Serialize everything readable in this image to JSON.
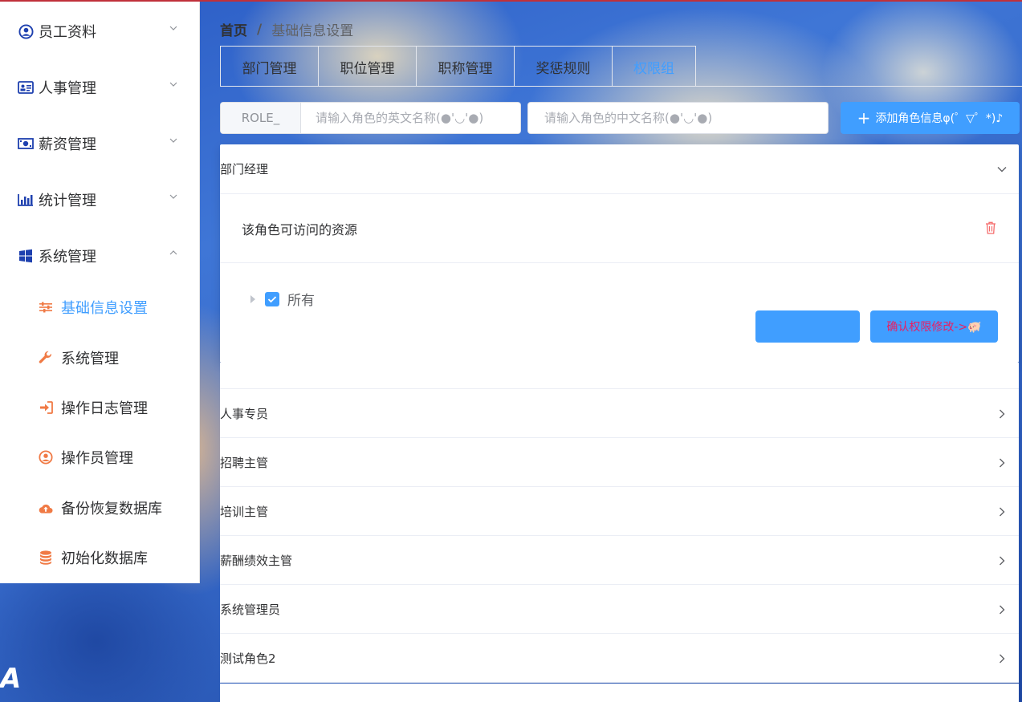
{
  "sidebar": {
    "menus": [
      {
        "label": "员工资料",
        "icon": "user-circle-icon"
      },
      {
        "label": "人事管理",
        "icon": "id-card-icon"
      },
      {
        "label": "薪资管理",
        "icon": "money-icon"
      },
      {
        "label": "统计管理",
        "icon": "bar-chart-icon"
      },
      {
        "label": "系统管理",
        "icon": "windows-icon"
      }
    ],
    "submenus": [
      {
        "label": "基础信息设置",
        "icon": "sliders-icon",
        "active": true
      },
      {
        "label": "系统管理",
        "icon": "wrench-icon"
      },
      {
        "label": "操作日志管理",
        "icon": "sign-in-icon"
      },
      {
        "label": "操作员管理",
        "icon": "user-circle-icon"
      },
      {
        "label": "备份恢复数据库",
        "icon": "cloud-upload-icon"
      },
      {
        "label": "初始化数据库",
        "icon": "database-icon"
      }
    ],
    "logo_text": "A"
  },
  "breadcrumb": {
    "home": "首页",
    "separator": "/",
    "current": "基础信息设置"
  },
  "tabs": [
    "部门管理",
    "职位管理",
    "职称管理",
    "奖惩规则",
    "权限组"
  ],
  "active_tab": "权限组",
  "role_form": {
    "prefix": "ROLE_",
    "en_placeholder": "请输入角色的英文名称(●'◡'●)",
    "cn_placeholder": "请输入角色的中文名称(●'◡'●)",
    "add_button": "添加角色信息φ(゜▽゜*)♪"
  },
  "expanded_role": {
    "name": "部门经理",
    "card_title": "该角色可访问的资源",
    "tree_root": "所有",
    "cancel_button": "",
    "confirm_button": "确认权限修改->🐖"
  },
  "roles": [
    "人事专员",
    "招聘主管",
    "培训主管",
    "薪酬绩效主管",
    "系统管理员",
    "测试角色2"
  ],
  "colors": {
    "primary": "#409eff",
    "danger": "#f56c6c",
    "menu_icon_blue": "#1e40af",
    "submenu_icon": "#f07a45",
    "confirm_text": "#e91e63"
  }
}
